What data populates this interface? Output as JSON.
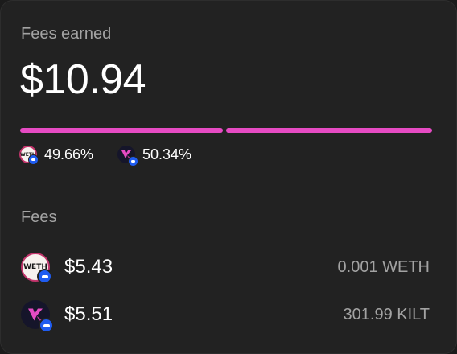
{
  "card": {
    "title": "Fees earned",
    "total": "$10.94",
    "accent_color": "#e64bc3",
    "split": [
      {
        "token": "WETH",
        "icon": "weth-token-icon",
        "share": 0.4966,
        "percent_label": "49.66%"
      },
      {
        "token": "KILT",
        "icon": "kilt-token-icon",
        "share": 0.5034,
        "percent_label": "50.34%"
      }
    ]
  },
  "fees": {
    "label": "Fees",
    "rows": [
      {
        "token": "WETH",
        "icon": "weth-token-icon",
        "icon_text": "WETH",
        "usd": "$5.43",
        "amount": "0.001 WETH"
      },
      {
        "token": "KILT",
        "icon": "kilt-token-icon",
        "usd": "$5.51",
        "amount": "301.99 KILT"
      }
    ]
  },
  "network_badge": {
    "icon": "base-chain-badge-icon",
    "color": "#1f5cf0"
  }
}
